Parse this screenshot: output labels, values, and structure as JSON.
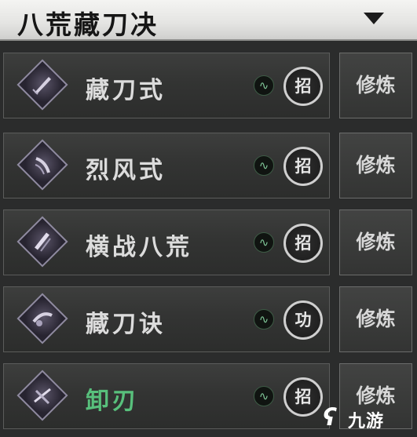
{
  "header": {
    "title": "八荒藏刀决"
  },
  "skills": [
    {
      "name": "藏刀式",
      "badge": "招",
      "button": "修炼",
      "active": false
    },
    {
      "name": "烈风式",
      "badge": "招",
      "button": "修炼",
      "active": false
    },
    {
      "name": "横战八荒",
      "badge": "招",
      "button": "修炼",
      "active": false
    },
    {
      "name": "藏刀诀",
      "badge": "功",
      "button": "修炼",
      "active": false
    },
    {
      "name": "卸刃",
      "badge": "招",
      "button": "修炼",
      "active": true
    }
  ],
  "switch_glyph": "∿",
  "colors": {
    "active_name": "#58c07c",
    "switch_glyph": "#7fc697"
  },
  "watermark": {
    "text": "九游"
  }
}
